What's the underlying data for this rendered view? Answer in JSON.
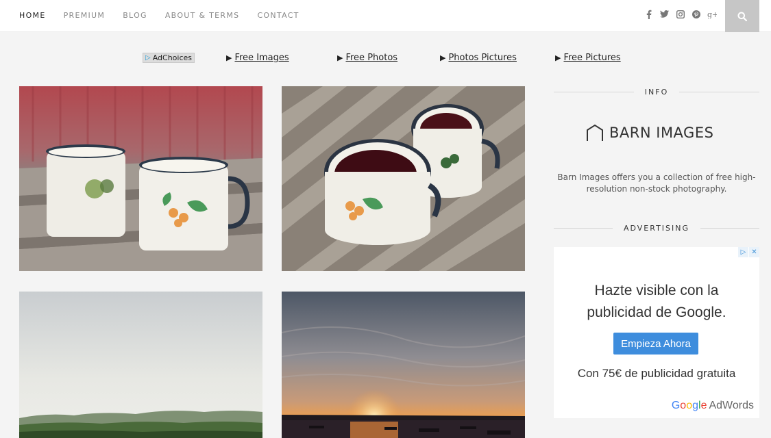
{
  "nav": {
    "items": [
      {
        "label": "HOME",
        "active": true
      },
      {
        "label": "PREMIUM",
        "active": false
      },
      {
        "label": "BLOG",
        "active": false
      },
      {
        "label": "ABOUT & TERMS",
        "active": false
      },
      {
        "label": "CONTACT",
        "active": false
      }
    ],
    "social": [
      {
        "icon": "facebook-icon",
        "glyph": "f"
      },
      {
        "icon": "twitter-icon",
        "glyph": "🐦"
      },
      {
        "icon": "instagram-icon",
        "glyph": "◘"
      },
      {
        "icon": "pinterest-icon",
        "glyph": "℗"
      },
      {
        "icon": "google-plus-icon",
        "glyph": "g+"
      }
    ],
    "search_icon": "search-icon"
  },
  "adrow": {
    "adchoices": "AdChoices",
    "links": [
      "Free Images",
      "Free Photos",
      "Photos Pictures",
      "Free Pictures"
    ]
  },
  "photos": [
    {
      "subject": "two enamel mugs with steam on wooden table",
      "palette": "warm"
    },
    {
      "subject": "two enamel mugs with dark drink, top view",
      "palette": "wood"
    },
    {
      "subject": "landscape with hazy sky over forest",
      "palette": "pale"
    },
    {
      "subject": "sunset over lake with boats",
      "palette": "sunset"
    }
  ],
  "sidebar": {
    "info_heading": "INFO",
    "logo_text": "BARN IMAGES",
    "description": "Barn Images offers you a collection of free high-resolution non-stock photography.",
    "advertising_heading": "ADVERTISING"
  },
  "ad": {
    "line1": "Hazte visible con la",
    "line2": "publicidad de Google.",
    "button": "Empieza Ahora",
    "line3": "Con 75€ de publicidad gratuita",
    "brand_google": "Google",
    "brand_adwords": "AdWords"
  },
  "colors": {
    "background": "#f4f4f4",
    "search_button": "#c6c6c6",
    "ad_button": "#3e8ddd"
  }
}
